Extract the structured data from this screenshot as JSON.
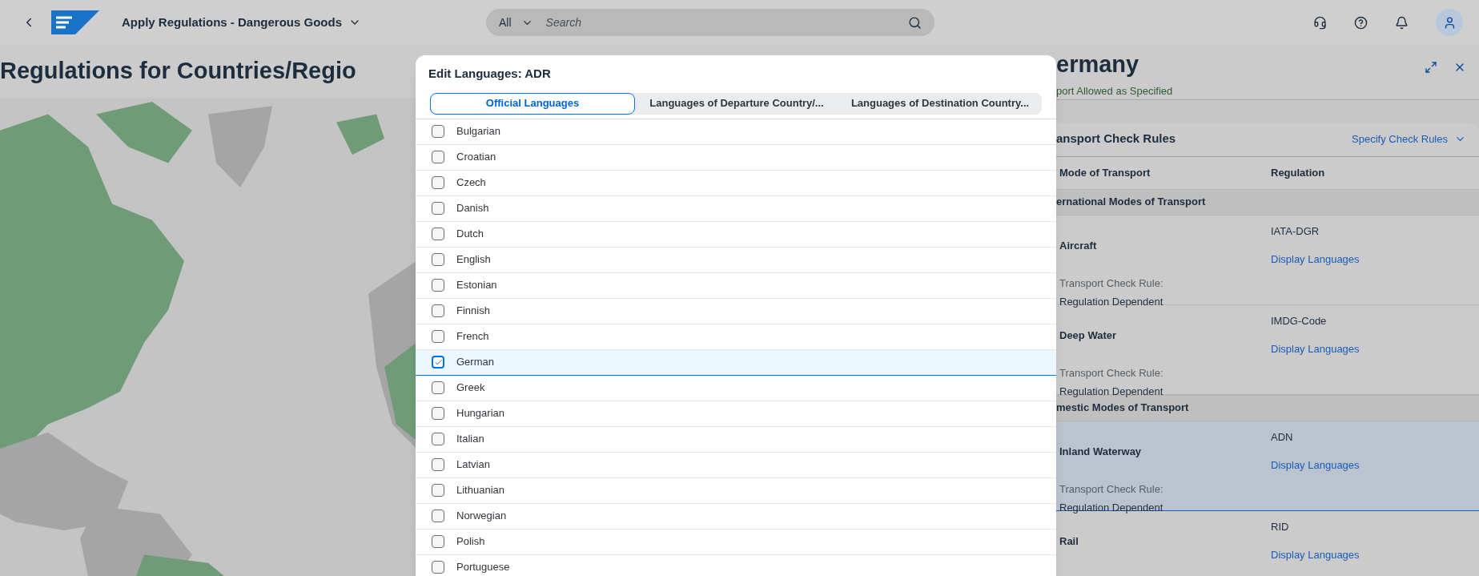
{
  "shell": {
    "title": "Apply Regulations - Dangerous Goods",
    "search": {
      "scope": "All",
      "placeholder": "Search"
    }
  },
  "page": {
    "title": "Regulations for Countries/Regio"
  },
  "dialog": {
    "title": "Edit Languages: ADR",
    "tabs": [
      {
        "label": "Official Languages",
        "selected": true
      },
      {
        "label": "Languages of Departure Country/...",
        "selected": false
      },
      {
        "label": "Languages of Destination Country...",
        "selected": false
      }
    ],
    "languages": [
      {
        "label": "Bulgarian",
        "checked": false,
        "selected": false
      },
      {
        "label": "Croatian",
        "checked": false,
        "selected": false
      },
      {
        "label": "Czech",
        "checked": false,
        "selected": false
      },
      {
        "label": "Danish",
        "checked": false,
        "selected": false
      },
      {
        "label": "Dutch",
        "checked": false,
        "selected": false
      },
      {
        "label": "English",
        "checked": false,
        "selected": false
      },
      {
        "label": "Estonian",
        "checked": false,
        "selected": false
      },
      {
        "label": "Finnish",
        "checked": false,
        "selected": false
      },
      {
        "label": "French",
        "checked": false,
        "selected": false
      },
      {
        "label": "German",
        "checked": true,
        "selected": true
      },
      {
        "label": "Greek",
        "checked": false,
        "selected": false
      },
      {
        "label": "Hungarian",
        "checked": false,
        "selected": false
      },
      {
        "label": "Italian",
        "checked": false,
        "selected": false
      },
      {
        "label": "Latvian",
        "checked": false,
        "selected": false
      },
      {
        "label": "Lithuanian",
        "checked": false,
        "selected": false
      },
      {
        "label": "Norwegian",
        "checked": false,
        "selected": false
      },
      {
        "label": "Polish",
        "checked": false,
        "selected": false
      },
      {
        "label": "Portuguese",
        "checked": false,
        "selected": false
      }
    ]
  },
  "details": {
    "title": "ermany",
    "status": "port Allowed as Specified",
    "section_title": "ansport Check Rules",
    "action": "Specify Check Rules",
    "columns": [
      "Mode of Transport",
      "Regulation"
    ],
    "groups": [
      {
        "title": "ernational Modes of Transport",
        "rows": [
          {
            "mode": "Aircraft",
            "regulation": "IATA-DGR",
            "link": "Display Languages",
            "rule_label": "Transport Check Rule:",
            "rule_value": "Regulation Dependent",
            "selected": false
          },
          {
            "mode": "Deep Water",
            "regulation": "IMDG-Code",
            "link": "Display Languages",
            "rule_label": "Transport Check Rule:",
            "rule_value": "Regulation Dependent",
            "selected": false
          }
        ]
      },
      {
        "title": "mestic Modes of Transport",
        "rows": [
          {
            "mode": "Inland Waterway",
            "regulation": "ADN",
            "link": "Display Languages",
            "rule_label": "Transport Check Rule:",
            "rule_value": "Regulation Dependent",
            "selected": true
          },
          {
            "mode": "Rail",
            "regulation": "RID",
            "link": "Display Languages",
            "selected": false
          }
        ]
      }
    ]
  }
}
